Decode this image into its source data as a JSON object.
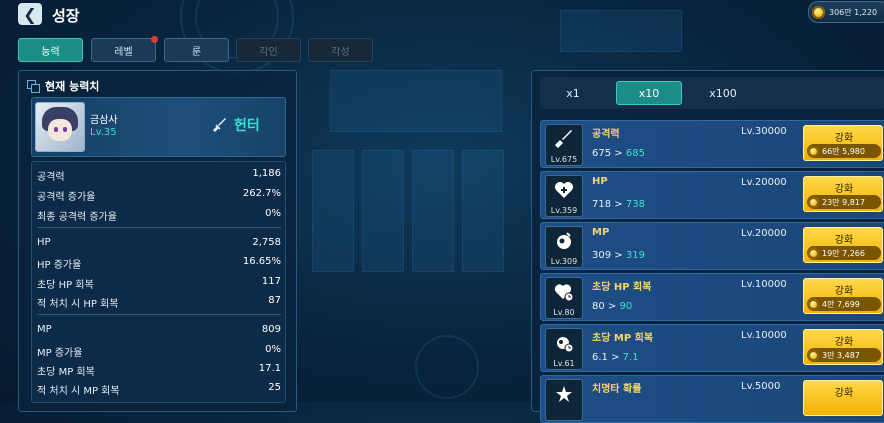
{
  "header": {
    "back_icon": "back-arrow-icon",
    "title": "성장",
    "currency": {
      "icon": "gold-coin-icon",
      "amount": "306만 1,220"
    }
  },
  "tabs": [
    {
      "label": "능력",
      "state": "active"
    },
    {
      "label": "레벨",
      "state": "normal",
      "notification": true
    },
    {
      "label": "룬",
      "state": "normal"
    },
    {
      "label": "각인",
      "state": "disabled"
    },
    {
      "label": "각성",
      "state": "disabled"
    }
  ],
  "stats_panel": {
    "title": "현재 능력치",
    "character": {
      "name": "금삼사",
      "level": "Lv.35",
      "class_label": "헌터",
      "class_icon": "sword-icon"
    },
    "stats": [
      {
        "label": "공격력",
        "value": "1,186"
      },
      {
        "label": "공격력 증가율",
        "value": "262.7%"
      },
      {
        "label": "최종 공격력 증가율",
        "value": "0%"
      },
      {
        "label": "HP",
        "value": "2,758"
      },
      {
        "label": "HP 증가율",
        "value": "16.65%"
      },
      {
        "label": "초당 HP 회복",
        "value": "117"
      },
      {
        "label": "적 처치 시 HP 회복",
        "value": "87"
      },
      {
        "label": "MP",
        "value": "809"
      },
      {
        "label": "MP 증가율",
        "value": "0%"
      },
      {
        "label": "초당 MP 회복",
        "value": "17.1"
      },
      {
        "label": "적 처치 시 MP 회복",
        "value": "25"
      }
    ]
  },
  "multipliers": [
    {
      "label": "x1",
      "active": false
    },
    {
      "label": "x10",
      "active": true
    },
    {
      "label": "x100",
      "active": false
    }
  ],
  "upgrades": [
    {
      "name": "공격력",
      "icon": "sword-icon",
      "level": "Lv.675",
      "max_level": "Lv.30000",
      "current": "675",
      "next": "685",
      "button": "강화",
      "cost": "66만 5,980"
    },
    {
      "name": "HP",
      "icon": "heart-plus-icon",
      "level": "Lv.359",
      "max_level": "Lv.20000",
      "current": "718",
      "next": "738",
      "button": "강화",
      "cost": "23만 9,817"
    },
    {
      "name": "MP",
      "icon": "mana-orb-icon",
      "level": "Lv.309",
      "max_level": "Lv.20000",
      "current": "309",
      "next": "319",
      "button": "강화",
      "cost": "19만 7,266"
    },
    {
      "name": "초당 HP 회복",
      "icon": "heart-clock-icon",
      "level": "Lv.80",
      "max_level": "Lv.10000",
      "current": "80",
      "next": "90",
      "button": "강화",
      "cost": "4만 7,699"
    },
    {
      "name": "초당 MP 회복",
      "icon": "orb-clock-icon",
      "level": "Lv.61",
      "max_level": "Lv.10000",
      "current": "6.1",
      "next": "7.1",
      "button": "강화",
      "cost": "3만 3,487"
    },
    {
      "name": "치명타 확률",
      "icon": "critical-icon",
      "level": "",
      "max_level": "Lv.5000",
      "current": "",
      "next": "",
      "button": "강화",
      "cost": ""
    }
  ]
}
